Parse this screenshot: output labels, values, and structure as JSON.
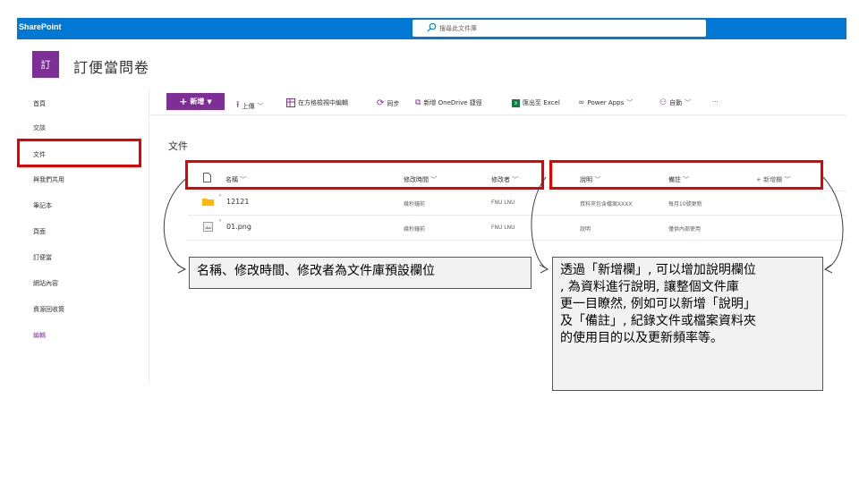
{
  "app": {
    "name": "SharePoint"
  },
  "search": {
    "placeholder": "搜尋此文件庫"
  },
  "site": {
    "logo_text": "訂",
    "title": "訂便當問卷"
  },
  "nav": {
    "items": [
      "首頁",
      "交談",
      "文件",
      "與我們共用",
      "筆記本",
      "頁面",
      "訂便當",
      "網站內容",
      "資源回收筒"
    ],
    "edit": "編輯"
  },
  "commands": {
    "new": "新增",
    "upload": "上傳",
    "grid_edit": "在方格檢視中編輯",
    "sync": "同步",
    "add_shortcut": "新增 OneDrive 捷徑",
    "export_excel": "匯出至 Excel",
    "power_apps": "Power Apps",
    "automate": "自動",
    "more": "···"
  },
  "library": {
    "title": "文件"
  },
  "columns": {
    "name": "名稱",
    "modified": "修改時間",
    "modified_by": "修改者",
    "description": "說明",
    "notes": "備註",
    "add_column": "+ 新增欄"
  },
  "rows": [
    {
      "icon": "folder-icon",
      "name": "12121",
      "modified": "幾秒鐘前",
      "modified_by": "FNU LNU",
      "description": "資料夾包含檔案XXXX",
      "notes": "每月10號更新"
    },
    {
      "icon": "image-file-icon",
      "name": "01.png",
      "modified": "幾秒鐘前",
      "modified_by": "FNU LNU",
      "description": "說明",
      "notes": "僅供內部使用"
    }
  ],
  "annotations": {
    "left": "名稱、修改時間、修改者為文件庫預設欄位",
    "right_lines": [
      "透過「新增欄」, 可以增加說明欄位",
      ", 為資料進行說明, 讓整個文件庫",
      "更一目瞭然, 例如可以新增「說明」",
      "及「備註」, 紀錄文件或檔案資料夾",
      "的使用目的以及更新頻率等。"
    ]
  },
  "colors": {
    "suite_bar": "#0078d4",
    "brand_purple": "#7d2f97",
    "highlight_red": "#e60000",
    "folder": "#ffb900"
  }
}
